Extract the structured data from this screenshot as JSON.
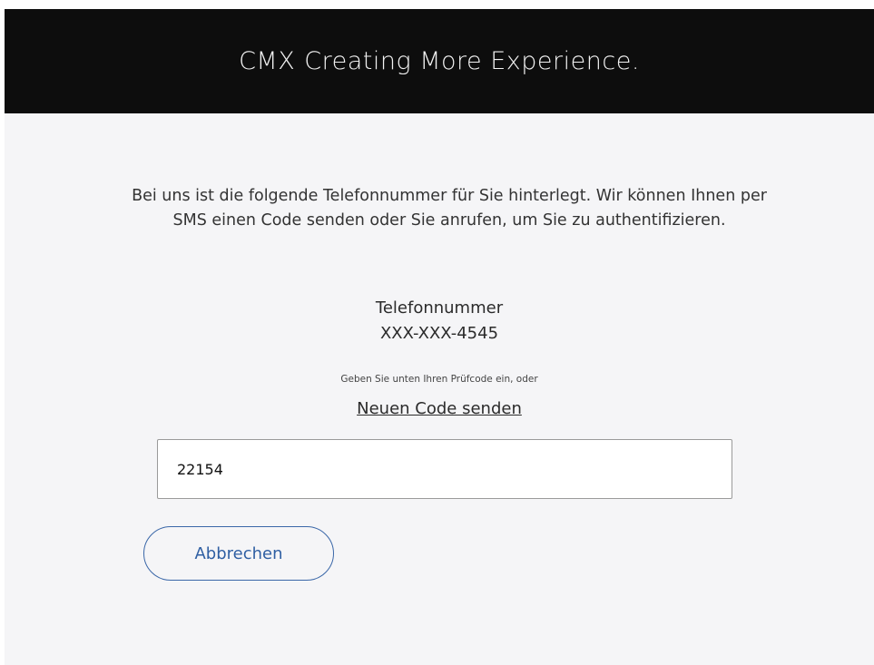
{
  "header": {
    "brand_name": "CMX",
    "tagline": "Creating More Experience.",
    "background_color": "#0d0d0d"
  },
  "main": {
    "intro_text": "Bei uns ist die folgende Telefonnummer für Sie hinterlegt. Wir können Ihnen per SMS einen Code senden oder Sie anrufen, um Sie zu authentifizieren.",
    "phone_label": "Telefonnummer",
    "phone_number": "XXX-XXX-4545",
    "hint_text": "Geben Sie unten Ihren Prüfcode ein, oder",
    "resend_link_label": "Neuen Code senden",
    "code_input_value": "22154",
    "cancel_button_label": "Abbrechen",
    "accent_color": "#2f5fa3"
  }
}
